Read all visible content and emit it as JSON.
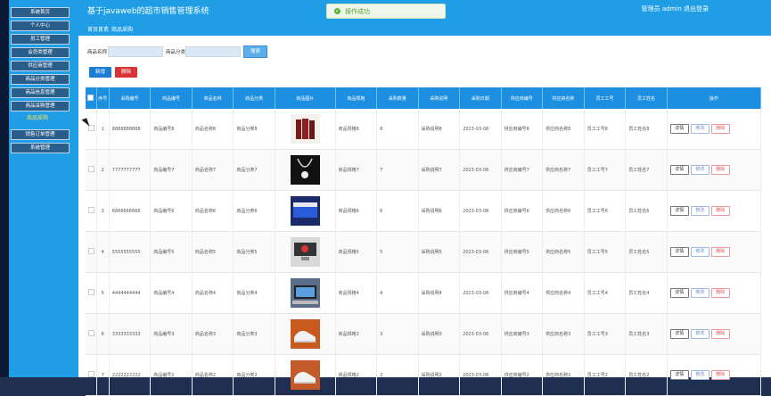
{
  "header": {
    "title": "基于javaweb的超市销售管理系统",
    "user": "管理员 admin  退出登录"
  },
  "toast": {
    "text": "操作成功",
    "icon": "check-circle-icon"
  },
  "breadcrumb": {
    "home": "首页首页",
    "sep": "/",
    "current": "商品采购"
  },
  "sidebar": {
    "items": [
      "系统首页",
      "个人中心",
      "员工管理",
      "会员类管理",
      "供应商管理",
      "商品分类管理",
      "商品信息管理",
      "商品采购管理"
    ],
    "sub_item": "商品采购",
    "items2": [
      "销售订单管理",
      "系统管理"
    ]
  },
  "search": {
    "label1": "商品名称",
    "label2": "商品分类",
    "button": "搜索"
  },
  "actions": {
    "add": "新增",
    "delete": "删除"
  },
  "table": {
    "headers": [
      "",
      "序号",
      "采购编号",
      "商品编号",
      "商品名称",
      "商品分类",
      "商品图片",
      "商品规格",
      "采购数量",
      "采购说明",
      "采购日期",
      "供应商编号",
      "供应商名称",
      "员工工号",
      "员工姓名",
      "操作"
    ],
    "row_buttons": [
      "详情",
      "修改",
      "删除"
    ],
    "rows": [
      {
        "no": "1",
        "purchase_no": "8888888888",
        "goods_no": "商品编号8",
        "goods_name": "商品名称8",
        "category": "商品分类8",
        "spec": "商品规格8",
        "qty": "8",
        "note": "采购说明8",
        "date": "2023-03-08",
        "supplier_no": "供应商编号8",
        "supplier_name": "供应商名称8",
        "emp_no": "员工工号8",
        "emp_name": "员工姓名8",
        "img": "books"
      },
      {
        "no": "2",
        "purchase_no": "7777777777",
        "goods_no": "商品编号7",
        "goods_name": "商品名称7",
        "category": "商品分类7",
        "spec": "商品规格7",
        "qty": "7",
        "note": "采购说明7",
        "date": "2023-03-08",
        "supplier_no": "供应商编号7",
        "supplier_name": "供应商名称7",
        "emp_no": "员工工号7",
        "emp_name": "员工姓名7",
        "img": "necklace"
      },
      {
        "no": "3",
        "purchase_no": "6666666666",
        "goods_no": "商品编号6",
        "goods_name": "商品名称6",
        "category": "商品分类6",
        "spec": "商品规格6",
        "qty": "6",
        "note": "采购说明6",
        "date": "2023-03-08",
        "supplier_no": "供应商编号6",
        "supplier_name": "供应商名称6",
        "emp_no": "员工工号6",
        "emp_name": "员工姓名6",
        "img": "tv"
      },
      {
        "no": "4",
        "purchase_no": "5555555555",
        "goods_no": "商品编号5",
        "goods_name": "商品名称5",
        "category": "商品分类5",
        "spec": "商品规格5",
        "qty": "5",
        "note": "采购说明5",
        "date": "2023-03-08",
        "supplier_no": "供应商编号5",
        "supplier_name": "供应商名称5",
        "emp_no": "员工工号5",
        "emp_name": "员工姓名5",
        "img": "monitor"
      },
      {
        "no": "5",
        "purchase_no": "4444444444",
        "goods_no": "商品编号4",
        "goods_name": "商品名称4",
        "category": "商品分类4",
        "spec": "商品规格4",
        "qty": "4",
        "note": "采购说明4",
        "date": "2023-03-08",
        "supplier_no": "供应商编号4",
        "supplier_name": "供应商名称4",
        "emp_no": "员工工号4",
        "emp_name": "员工姓名4",
        "img": "desk"
      },
      {
        "no": "6",
        "purchase_no": "3333333333",
        "goods_no": "商品编号3",
        "goods_name": "商品名称3",
        "category": "商品分类3",
        "spec": "商品规格3",
        "qty": "3",
        "note": "采购说明3",
        "date": "2023-03-08",
        "supplier_no": "供应商编号3",
        "supplier_name": "供应商名称3",
        "emp_no": "员工工号3",
        "emp_name": "员工姓名3",
        "img": "shoes"
      },
      {
        "no": "7",
        "purchase_no": "2222222222",
        "goods_no": "商品编号2",
        "goods_name": "商品名称2",
        "category": "商品分类2",
        "spec": "商品规格2",
        "qty": "2",
        "note": "采购说明2",
        "date": "2023-03-08",
        "supplier_no": "供应商编号2",
        "supplier_name": "供应商名称2",
        "emp_no": "员工工号2",
        "emp_name": "员工姓名2",
        "img": "shoes2"
      }
    ]
  },
  "colors": {
    "primary": "#1f9ee6",
    "table_head": "#1c8fe0",
    "danger": "#d83434"
  }
}
